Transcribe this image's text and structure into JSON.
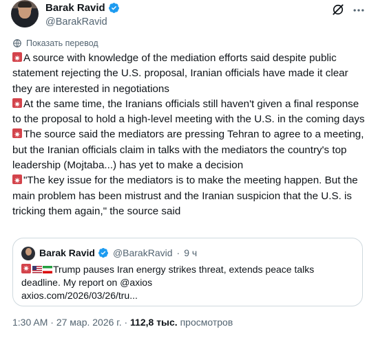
{
  "author": {
    "name": "Barak Ravid",
    "handle": "@BarakRavid"
  },
  "translate_label": "Показать перевод",
  "paragraphs": [
    "A source with knowledge of the mediation efforts said despite public statement rejecting the U.S. proposal, Iranian officials have made it clear they are interested in negotiations",
    "At the same time, the Iranians officials still haven't given a final response to the proposal to hold a high-level meeting with the U.S. in the coming days",
    "The source said the mediators are pressing Tehran to agree to a meeting, but the Iranian officials claim in talks with the mediators the country's top leadership (Mojtaba...) has yet to make a decision",
    "\"The key issue for the mediators is to make the meeting happen. But the main problem has been mistrust and the Iranian suspicion that the U.S. is tricking them again,\" the source said"
  ],
  "quote": {
    "name": "Barak Ravid",
    "handle": "@BarakRavid",
    "separator": "·",
    "time": "9 ч",
    "text": "Trump pauses Iran energy strikes threat, extends peace talks deadline. My report on @axios",
    "link": "axios.com/2026/03/26/tru..."
  },
  "meta": {
    "time": "1:30 AM",
    "date": "27 мар. 2026 г.",
    "views_count": "112,8 тыс.",
    "views_label": "просмотров",
    "separator": "·"
  },
  "colors": {
    "accent": "#1d9bf0",
    "secondary_text": "#536471",
    "border": "#cfd9de"
  }
}
